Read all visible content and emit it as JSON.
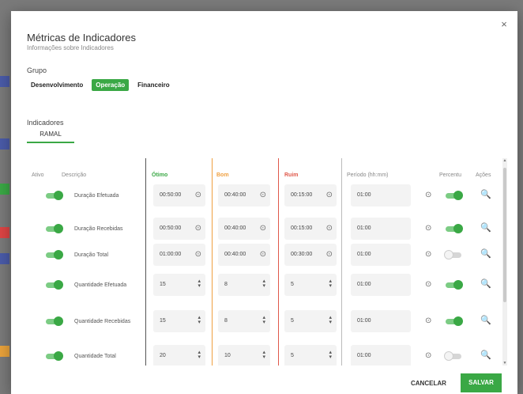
{
  "dialog": {
    "title": "Métricas de Indicadores",
    "subtitle": "Informações sobre Indicadores",
    "close_icon": "×"
  },
  "group": {
    "label": "Grupo",
    "tabs": [
      "Desenvolvimento",
      "Operação",
      "Financeiro"
    ],
    "active_tab": "Operação"
  },
  "indicators": {
    "label": "Indicadores",
    "subtab": "RAMAL"
  },
  "table": {
    "headers": {
      "ativo": "Ativo",
      "descricao": "Descrição",
      "otimo": "Ótimo",
      "bom": "Bom",
      "ruim": "Ruim",
      "periodo": "Período (hh:mm)",
      "percentual": "Percentu",
      "acoes": "Ações"
    },
    "rows": [
      {
        "ativo": "on",
        "descricao": "Duração Efetuada",
        "otimo": "00:50:00",
        "bom": "00:40:00",
        "ruim": "00:15:00",
        "periodo": "01:00",
        "percentual": "on",
        "field_type": "time"
      },
      {
        "ativo": "on",
        "descricao": "Duração Recebidas",
        "otimo": "00:50:00",
        "bom": "00:40:00",
        "ruim": "00:15:00",
        "periodo": "01:00",
        "percentual": "on",
        "field_type": "time"
      },
      {
        "ativo": "on",
        "descricao": "Duração Total",
        "otimo": "01:00:00",
        "bom": "00:40:00",
        "ruim": "00:30:00",
        "periodo": "01:00",
        "percentual": "off",
        "field_type": "time"
      },
      {
        "ativo": "on",
        "descricao": "Quantidade Efetuada",
        "otimo": "15",
        "bom": "8",
        "ruim": "5",
        "periodo": "01:00",
        "percentual": "on",
        "field_type": "number"
      },
      {
        "ativo": "on",
        "descricao": "Quantidade Recebidas",
        "otimo": "15",
        "bom": "8",
        "ruim": "5",
        "periodo": "01:00",
        "percentual": "on",
        "field_type": "number"
      },
      {
        "ativo": "on",
        "descricao": "Quantidade Total",
        "otimo": "20",
        "bom": "10",
        "ruim": "5",
        "periodo": "01:00",
        "percentual": "off",
        "field_type": "number"
      }
    ]
  },
  "footer": {
    "cancel": "CANCELAR",
    "save": "SALVAR"
  },
  "icons": {
    "clock": "clock-icon",
    "spinner": "spinner-icon",
    "search": "search-icon"
  },
  "colors": {
    "accent_green": "#3aa845",
    "bom_orange": "#f0a040",
    "ruim_red": "#e0584a"
  }
}
